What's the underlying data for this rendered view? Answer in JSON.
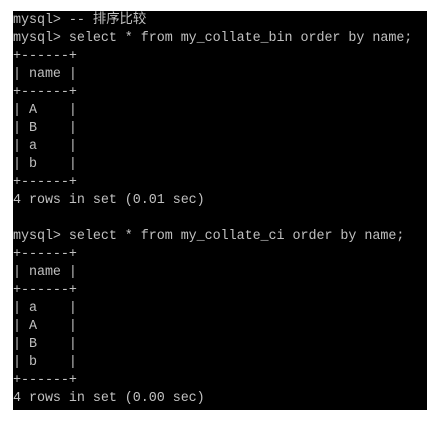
{
  "terminal": {
    "background": "#000000",
    "foreground": "#c0c0c0",
    "lines": [
      "mysql> -- 排序比较",
      "mysql> select * from my_collate_bin order by name;",
      "+------+",
      "| name |",
      "+------+",
      "| A    |",
      "| B    |",
      "| a    |",
      "| b    |",
      "+------+",
      "4 rows in set (0.01 sec)",
      "",
      "mysql> select * from my_collate_ci order by name;",
      "+------+",
      "| name |",
      "+------+",
      "| a    |",
      "| A    |",
      "| B    |",
      "| b    |",
      "+------+",
      "4 rows in set (0.00 sec)"
    ]
  }
}
